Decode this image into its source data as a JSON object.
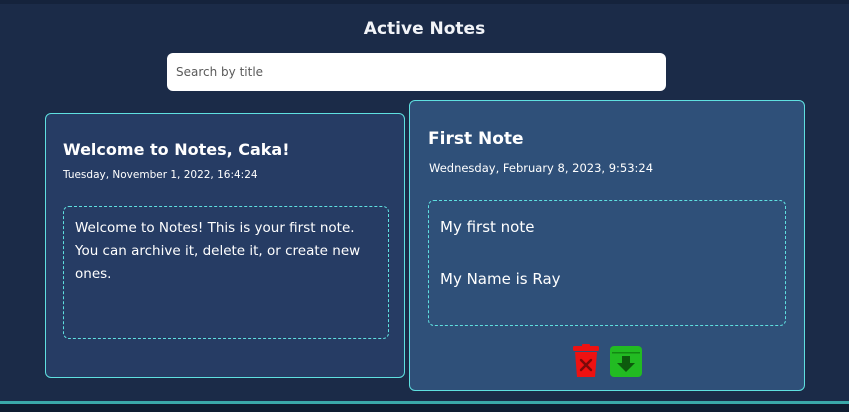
{
  "header": {
    "title": "Active Notes"
  },
  "search": {
    "placeholder": "Search by title",
    "value": ""
  },
  "notes": [
    {
      "title": "Welcome to Notes, Caka!",
      "date": "Tuesday, November 1, 2022, 16:4:24",
      "body": [
        "Welcome to Notes! This is your first note. You can archive it, delete it, or create new ones."
      ]
    },
    {
      "title": "First Note",
      "date": "Wednesday, February 8, 2023, 9:53:24",
      "body": [
        "My first note",
        "",
        "My Name is Ray"
      ],
      "actions": [
        {
          "name": "delete",
          "icon": "trash-icon",
          "color": "#ee1111"
        },
        {
          "name": "archive",
          "icon": "archive-down-icon",
          "color": "#22bb22"
        }
      ]
    }
  ],
  "colors": {
    "background": "#1b2b48",
    "card_primary": "#263c64",
    "card_hover": "#2f5079",
    "accent_border": "#5fe0e0",
    "delete": "#ee1111",
    "archive": "#22bb22"
  }
}
